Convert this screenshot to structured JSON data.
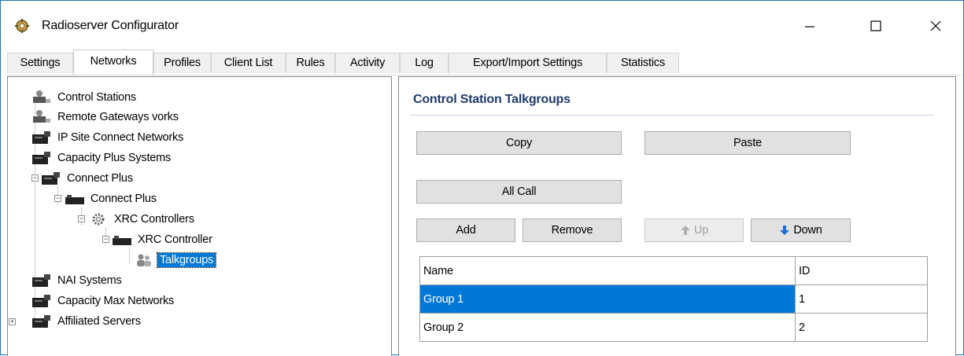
{
  "window": {
    "title": "Radioserver Configurator",
    "icon": "gear-wrench-icon"
  },
  "controls": {
    "minimize": "minimize-icon",
    "maximize": "maximize-icon",
    "close": "close-icon"
  },
  "tabs": [
    {
      "label": "Settings",
      "active": false
    },
    {
      "label": "Networks",
      "active": true
    },
    {
      "label": "Profiles",
      "active": false
    },
    {
      "label": "Client List",
      "active": false
    },
    {
      "label": "Rules",
      "active": false
    },
    {
      "label": "Activity",
      "active": false
    },
    {
      "label": "Log",
      "active": false
    },
    {
      "label": "Export/Import Settings",
      "active": false
    },
    {
      "label": "Statistics",
      "active": false
    }
  ],
  "tree": {
    "control_stations": "Control Stations",
    "remote_gateways": "Remote Gateways  vorks",
    "ip_site": "IP Site Connect Networks",
    "capacity_plus": "Capacity Plus Systems",
    "connect_plus_root": "Connect Plus",
    "connect_plus": "Connect Plus",
    "xrc_controllers": "XRC Controllers",
    "xrc_controller": "XRC Controller",
    "talkgroups": "Talkgroups",
    "nai": "NAI Systems",
    "capacity_max": "Capacity Max Networks",
    "affiliated": "Affiliated Servers"
  },
  "panel": {
    "title": "Control Station Talkgroups",
    "copy": "Copy",
    "paste": "Paste",
    "all_call": "All Call",
    "add": "Add",
    "remove": "Remove",
    "up": "Up",
    "down": "Down"
  },
  "table": {
    "headers": {
      "name": "Name",
      "id": "ID"
    },
    "rows": [
      {
        "name": "Group 1",
        "id": "1",
        "selected": true
      },
      {
        "name": "Group 2",
        "id": "2",
        "selected": false
      }
    ]
  }
}
